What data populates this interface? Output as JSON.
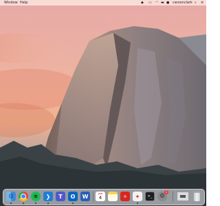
{
  "menubar": {
    "items": [
      "Window",
      "Help"
    ],
    "user_name": "carsonclark",
    "status_icons": [
      "dropbox-icon",
      "display-icon",
      "wifi-icon",
      "battery-icon",
      "user-icon",
      "search-icon",
      "list-icon"
    ]
  },
  "wallpaper": {
    "name": "OS X Yosemite Half Dome"
  },
  "dock": {
    "apps": [
      {
        "name": "finder-icon",
        "color": "#5aa4e8"
      },
      {
        "name": "chrome-icon",
        "color": "#e8e8e8"
      },
      {
        "name": "spotify-icon",
        "color": "#1db954"
      },
      {
        "name": "vscode-icon",
        "color": "#1f7fd4"
      },
      {
        "name": "teams-icon",
        "color": "#5059c9"
      },
      {
        "name": "outlook-icon",
        "color": "#0a64c2"
      },
      {
        "name": "word-icon",
        "color": "#2b5eb4"
      },
      {
        "name": "calendar-icon",
        "color": "#ffffff"
      },
      {
        "name": "notes-icon",
        "color": "#f7d154"
      },
      {
        "name": "acrobat-icon",
        "color": "#d7271f"
      },
      {
        "name": "pdf-icon",
        "color": "#f2f2f2"
      },
      {
        "name": "terminal-icon",
        "color": "#1e1e1e"
      },
      {
        "name": "system-preferences-icon",
        "color": "#8a8a8a"
      },
      {
        "name": "screen-window-icon",
        "color": "#dcdcdc"
      },
      {
        "name": "trash-icon",
        "color": "#c8c8cc"
      }
    ],
    "calendar_day": "4",
    "calendar_month": "JUN",
    "settings_badge": "1"
  }
}
